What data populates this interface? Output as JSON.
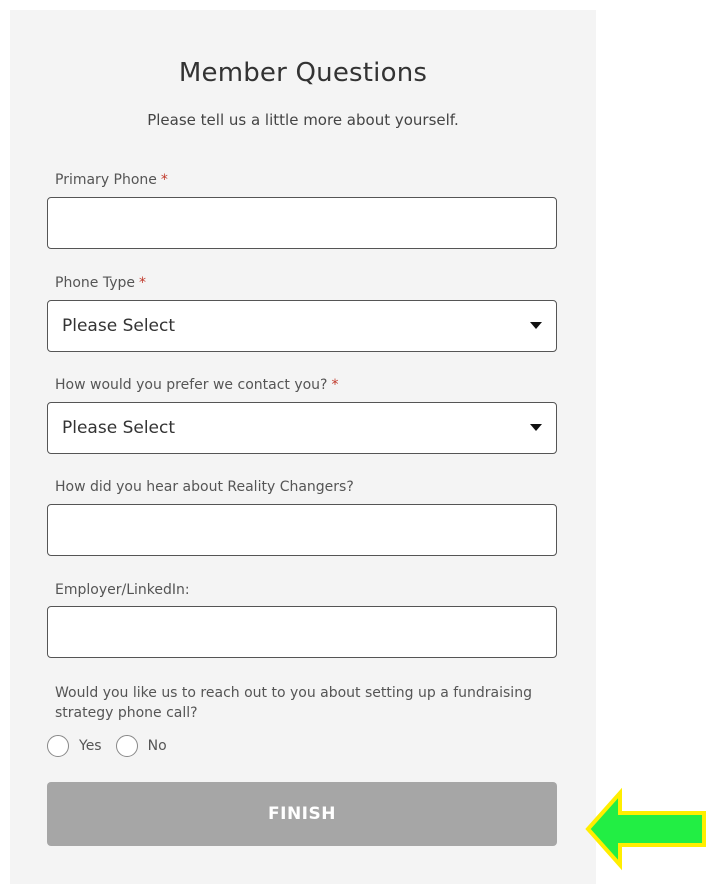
{
  "form": {
    "title": "Member Questions",
    "subtitle": "Please tell us a little more about yourself.",
    "required_marker": "*",
    "primary_phone": {
      "label": "Primary Phone",
      "value": ""
    },
    "phone_type": {
      "label": "Phone Type",
      "selected": "Please Select"
    },
    "contact_preference": {
      "label": "How would you prefer we contact you?",
      "selected": "Please Select"
    },
    "referral_source": {
      "label": "How did you hear about Reality Changers?",
      "value": ""
    },
    "employer": {
      "label": "Employer/LinkedIn:",
      "value": ""
    },
    "strategy_call": {
      "question": "Would you like us to reach out to you about setting up a fundraising strategy phone call?",
      "options": [
        "Yes",
        "No"
      ]
    },
    "finish_label": "FINISH"
  },
  "colors": {
    "panel_background": "#f4f4f4",
    "required": "#c0392b",
    "button_disabled": "#a6a6a6",
    "arrow_fill": "#22ee44",
    "arrow_outline": "#ffee00"
  },
  "annotation": {
    "icon": "arrow-left-icon"
  }
}
